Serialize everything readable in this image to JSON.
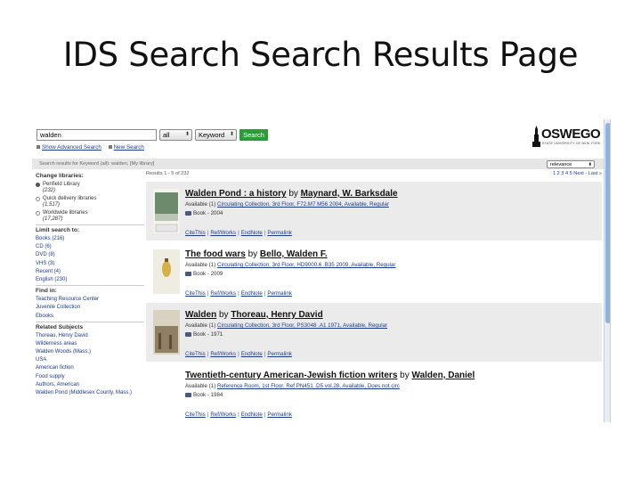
{
  "slide": {
    "title": "IDS Search Search Results Page"
  },
  "header": {
    "search_value": "walden",
    "scope_select": "all",
    "field_select": "Keyword",
    "search_button": "Search",
    "advanced_link": "Show Advanced Search",
    "new_search_link": "New Search",
    "logo_word": "OSWEGO",
    "logo_sub": "STATE UNIVERSITY OF NEW YORK"
  },
  "infobar": {
    "text": "Search results for Keyword (all): walden, [My library]",
    "sort_select": "relevance"
  },
  "sidebar": {
    "change_libraries": "Change libraries:",
    "libraries": [
      {
        "label": "Penfield Library",
        "count": "(232)",
        "selected": true
      },
      {
        "label": "Quick delivery libraries",
        "count": "(1,517)",
        "selected": false
      },
      {
        "label": "Worldwide libraries",
        "count": "(17,287)",
        "selected": false
      }
    ],
    "limit_head": "Limit search to:",
    "limits": [
      "Books (216)",
      "CD (6)",
      "DVD (8)",
      "VHS (3)",
      "Recent (4)",
      "English (230)"
    ],
    "find_head": "Find in:",
    "find": [
      "Teaching Resource Center",
      "Juvenile Collection",
      "Ebooks"
    ],
    "subjects_head": "Related Subjects",
    "subjects": [
      "Thoreau, Henry David",
      "Wilderness areas",
      "Walden Woods (Mass.)",
      "USA",
      "American fiction",
      "Food supply",
      "Authors, American",
      "Walden Pond (Middlesex County, Mass.)"
    ]
  },
  "pager": {
    "left": "Results 1 - 5 of 232",
    "right": "1 2 3 4 5 Next - Last »"
  },
  "results": [
    {
      "title": "Walden Pond : a history",
      "by": "by",
      "author": "Maynard, W. Barksdale",
      "avail_prefix": "Available (1)",
      "avail_link": "Circulating Collection, 3rd Floor, F72.M7 M56 2004, Available, Regular",
      "format": "Book - 2004",
      "links": [
        "CiteThis",
        "Ref/Works",
        "EndNote",
        "Permalink"
      ],
      "cover_color": "#6e8a6c"
    },
    {
      "title": "The food wars",
      "by": "by",
      "author": "Bello, Walden F.",
      "avail_prefix": "Available (1)",
      "avail_link": "Circulating Collection, 3rd Floor, HD9000.6 .B35 2009, Available, Regular",
      "format": "Book - 2009",
      "links": [
        "CiteThis",
        "Ref/Works",
        "EndNote",
        "Permalink"
      ],
      "cover_color": "#e9e4d2"
    },
    {
      "title": "Walden",
      "by": "by",
      "author": "Thoreau, Henry David",
      "avail_prefix": "Available (1)",
      "avail_link": "Circulating Collection, 3rd Floor, PS3048 .A1 1971, Available, Regular",
      "format": "Book - 1971",
      "links": [
        "CiteThis",
        "Ref/Works",
        "EndNote",
        "Permalink"
      ],
      "cover_color": "#8f7f63"
    },
    {
      "title": "Twentieth-century American-Jewish fiction writers",
      "by": "by",
      "author": "Walden, Daniel",
      "avail_prefix": "Available (1)",
      "avail_link": "Reference Room, 1st Floor, Ref PN451 .D5 vol.28, Available, Does not circ",
      "format": "Book - 1984",
      "links": [
        "CiteThis",
        "Ref/Works",
        "EndNote",
        "Permalink"
      ],
      "cover_color": ""
    }
  ]
}
